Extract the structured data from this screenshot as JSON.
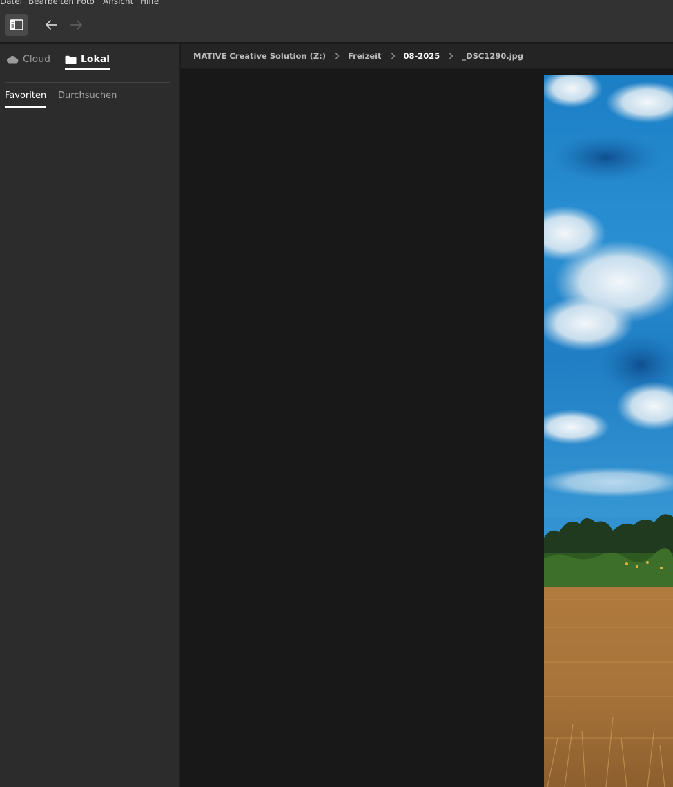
{
  "menu": {
    "items": [
      "Datei",
      "Bearbeiten",
      "Foto",
      "Ansicht",
      "Hilfe"
    ]
  },
  "toolbar": {
    "panel_toggle_icon": "panel-toggle-icon",
    "back_icon": "arrow-left-icon",
    "forward_icon": "arrow-right-icon"
  },
  "sidebar": {
    "source_tabs": [
      {
        "label": "Cloud",
        "icon": "cloud-icon",
        "active": false
      },
      {
        "label": "Lokal",
        "icon": "folder-icon",
        "active": true
      }
    ],
    "sub_tabs": [
      {
        "label": "Favoriten",
        "active": true
      },
      {
        "label": "Durchsuchen",
        "active": false
      }
    ]
  },
  "breadcrumb": {
    "items": [
      "MATIVE Creative Solution (Z:)",
      "Freizeit",
      "08-2025",
      "_DSC1290.jpg"
    ],
    "current_index": 2
  },
  "colors": {
    "accent": "#ffffff",
    "sidebar_bg": "#2c2c2c",
    "viewer_bg": "#181818",
    "toolbar_bg": "#323232"
  }
}
